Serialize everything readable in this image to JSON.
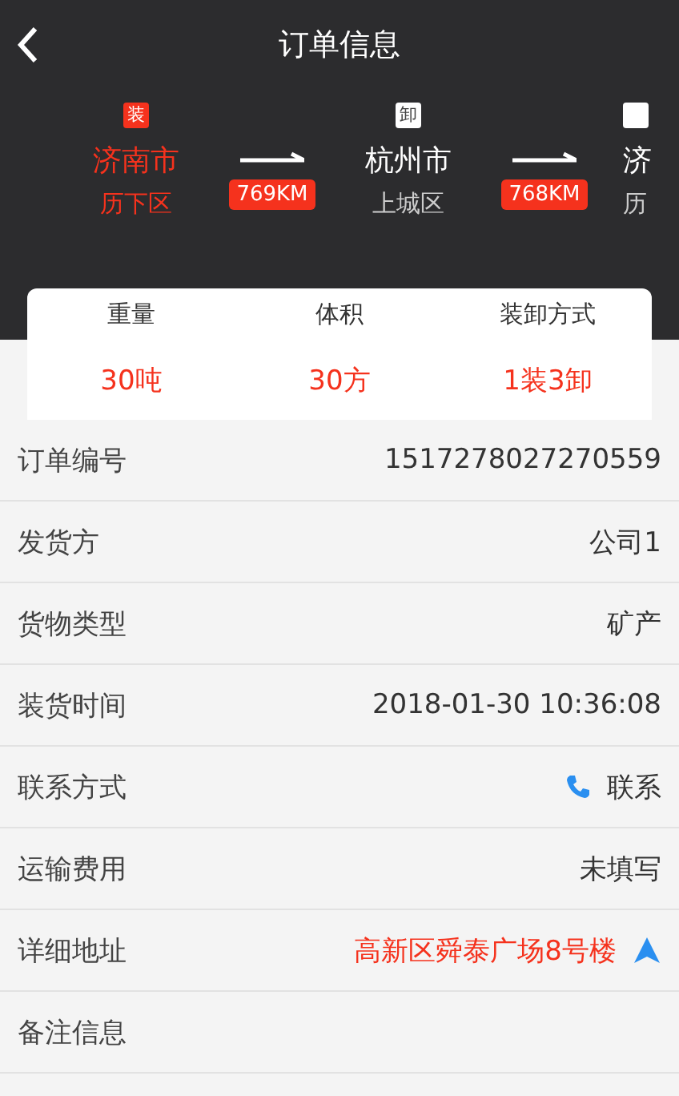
{
  "header": {
    "title": "订单信息"
  },
  "route": {
    "stops": [
      {
        "kind": "load",
        "badge": "装",
        "city": "济南市",
        "district": "历下区"
      },
      {
        "kind": "unload",
        "badge": "卸",
        "city": "杭州市",
        "district": "上城区"
      },
      {
        "kind": "unload",
        "city": "济",
        "district": "历"
      }
    ],
    "legs": [
      {
        "distance": "769KM"
      },
      {
        "distance": "768KM"
      }
    ]
  },
  "summary": [
    {
      "label": "重量",
      "value": "30吨"
    },
    {
      "label": "体积",
      "value": "30方"
    },
    {
      "label": "装卸方式",
      "value": "1装3卸"
    }
  ],
  "details": [
    {
      "kind": "text",
      "label": "订单编号",
      "value": "1517278027270559"
    },
    {
      "kind": "text",
      "label": "发货方",
      "value": "公司1"
    },
    {
      "kind": "text",
      "label": "货物类型",
      "value": "矿产"
    },
    {
      "kind": "text",
      "label": "装货时间",
      "value": "2018-01-30 10:36:08"
    },
    {
      "kind": "phone",
      "label": "联系方式",
      "value": "联系"
    },
    {
      "kind": "text",
      "label": "运输费用",
      "value": "未填写"
    },
    {
      "kind": "address",
      "label": "详细地址",
      "value": "高新区舜泰广场8号楼"
    },
    {
      "kind": "empty",
      "label": "备注信息"
    }
  ]
}
